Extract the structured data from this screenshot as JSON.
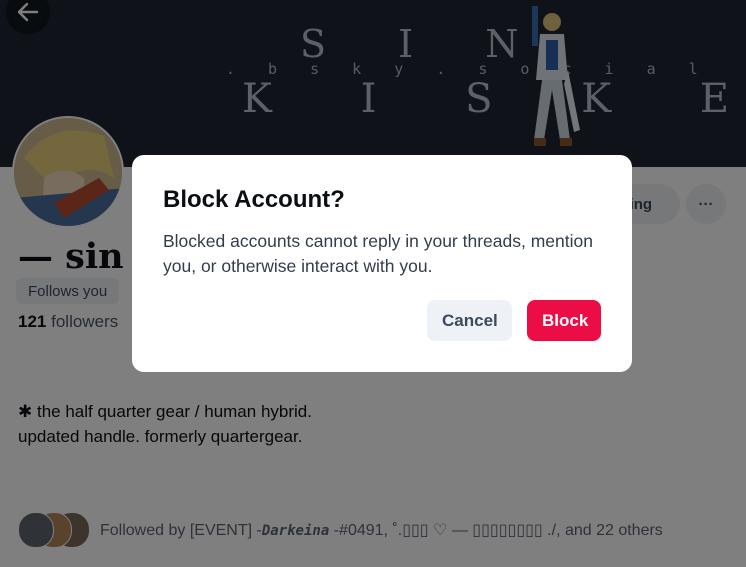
{
  "header": {
    "back_icon": "arrow-left-icon",
    "banner_title_line1": "S I N",
    "banner_handle": ". b s k y . s o c i a l",
    "banner_title_line2": "K I S K E"
  },
  "profile": {
    "display_name": "— sin k",
    "follow_button_partial": "wing",
    "more_icon": "ellipsis-icon",
    "more_label": "···",
    "follows_you": "Follows you",
    "followers_count": "121",
    "followers_label": "followers",
    "bio_line1": "✱ the half quarter gear / human hybrid.",
    "bio_line2": "updated handle. formerly quartergear.",
    "followed_by_prefix": "Followed by [EVENT] -",
    "followed_by_name1": "Darkeina",
    "followed_by_rest": " -#0491, ˚.▯▯▯ ♡ — ▯▯▯▯▯▯▯▯ ./, and 22 others"
  },
  "dialog": {
    "title": "Block Account?",
    "message": "Blocked accounts cannot reply in your threads, mention you, or otherwise interact with you.",
    "cancel_label": "Cancel",
    "block_label": "Block"
  },
  "colors": {
    "banner": "#1e2531",
    "block_button": "#ec0c46",
    "secondary_button": "#eef1f5"
  }
}
